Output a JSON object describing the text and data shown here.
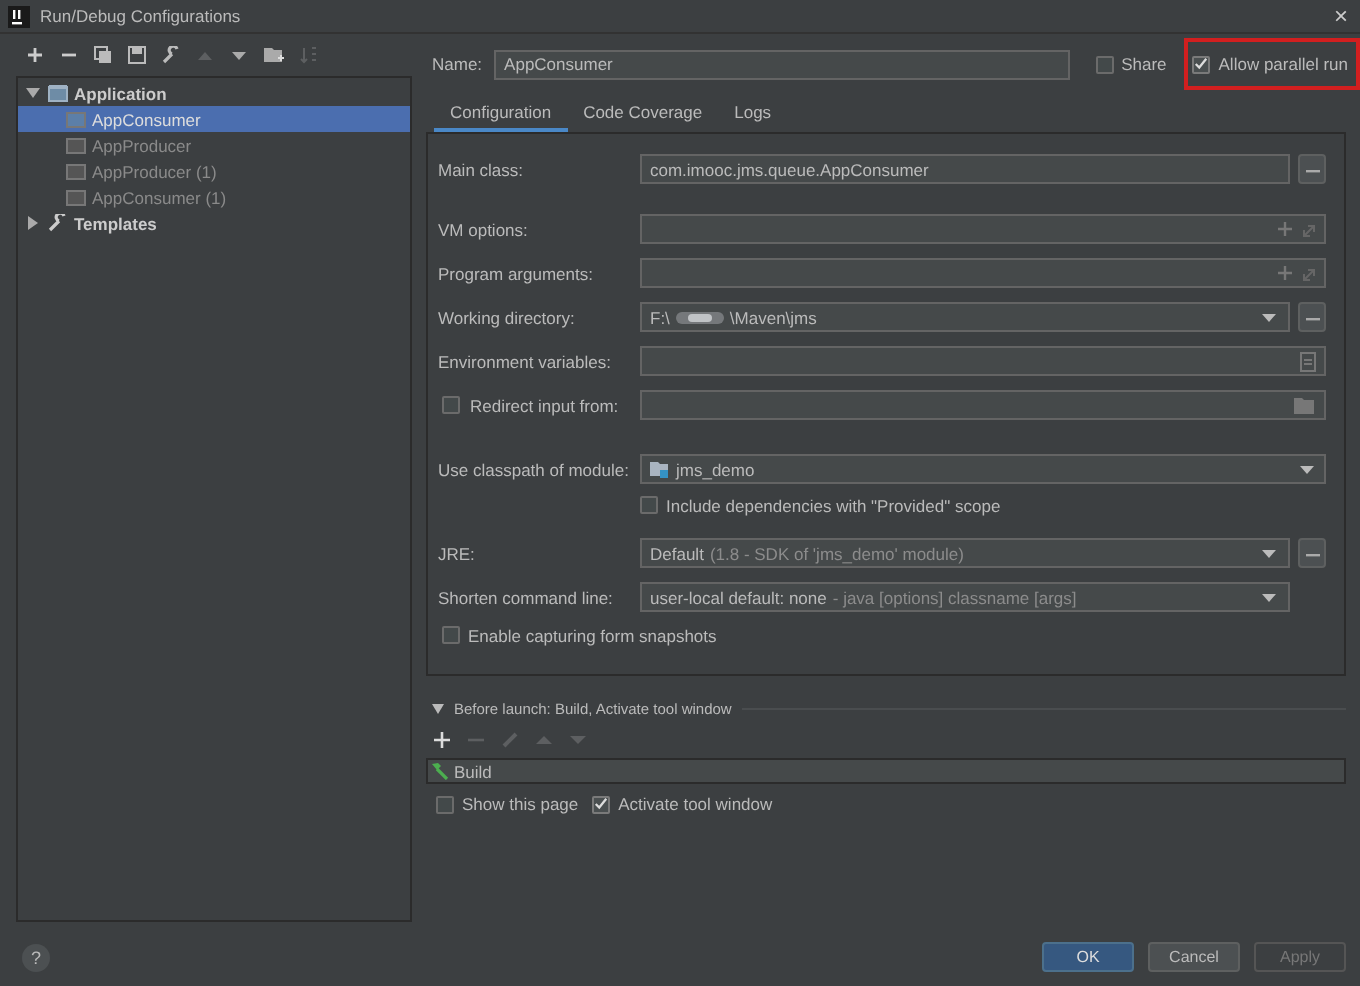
{
  "window": {
    "title": "Run/Debug Configurations",
    "close": "×"
  },
  "tree": [
    {
      "label": "Application",
      "kind": "folder",
      "expanded": true,
      "selected": false,
      "children": [
        {
          "label": "AppConsumer",
          "selected": true
        },
        {
          "label": "AppProducer",
          "selected": false
        },
        {
          "label": "AppProducer (1)",
          "selected": false
        },
        {
          "label": "AppConsumer (1)",
          "selected": false
        }
      ]
    },
    {
      "label": "Templates",
      "kind": "wrench",
      "expanded": false,
      "selected": false
    }
  ],
  "name": {
    "label": "Name:",
    "value": "AppConsumer"
  },
  "options": [
    {
      "label": "Share",
      "checked": false,
      "highlighted": false
    },
    {
      "label": "Allow parallel run",
      "checked": true,
      "highlighted": true
    }
  ],
  "tabs": [
    {
      "label": "Configuration",
      "selected": true
    },
    {
      "label": "Code Coverage",
      "selected": false
    },
    {
      "label": "Logs",
      "selected": false
    }
  ],
  "rows": [
    {
      "kind": "text",
      "label": "Main class:",
      "value": "com.imooc.jms.queue.AppConsumer",
      "browse": true
    },
    {
      "kind": "expand",
      "label": "VM options:"
    },
    {
      "kind": "expand",
      "label": "Program arguments:"
    },
    {
      "kind": "combo",
      "label": "Working directory:",
      "value": "F:\\",
      "value_end": "\\Maven\\jms",
      "browse": true
    },
    {
      "kind": "env",
      "label": "Environment variables:"
    },
    {
      "kind": "redirect",
      "label": "Redirect input from:",
      "checked": false
    },
    {
      "kind": "module",
      "label": "Use classpath of module:",
      "value": "jms_demo"
    },
    {
      "kind": "check",
      "label": "Include dependencies with \"Provided\" scope",
      "checked": false
    },
    {
      "kind": "combo",
      "label": "JRE:",
      "value": "Default",
      "detail": "(1.8 - SDK of 'jms_demo' module)",
      "browse": true
    },
    {
      "kind": "combo",
      "label": "Shorten command line:",
      "value": "user-local default: none",
      "detail": "- java [options] classname [args]"
    },
    {
      "kind": "check_left",
      "label": "Enable capturing form snapshots",
      "checked": false
    }
  ],
  "before_launch": {
    "title": "Before launch: Build, Activate tool window",
    "expanded": true,
    "tasks": [
      {
        "label": "Build"
      }
    ],
    "checks": [
      {
        "label": "Show this page",
        "checked": false
      },
      {
        "label": "Activate tool window",
        "checked": true
      }
    ]
  },
  "help": "?",
  "buttons": [
    {
      "label": "OK",
      "kind": "primary"
    },
    {
      "label": "Cancel",
      "kind": "normal"
    },
    {
      "label": "Apply",
      "kind": "disabled"
    }
  ]
}
